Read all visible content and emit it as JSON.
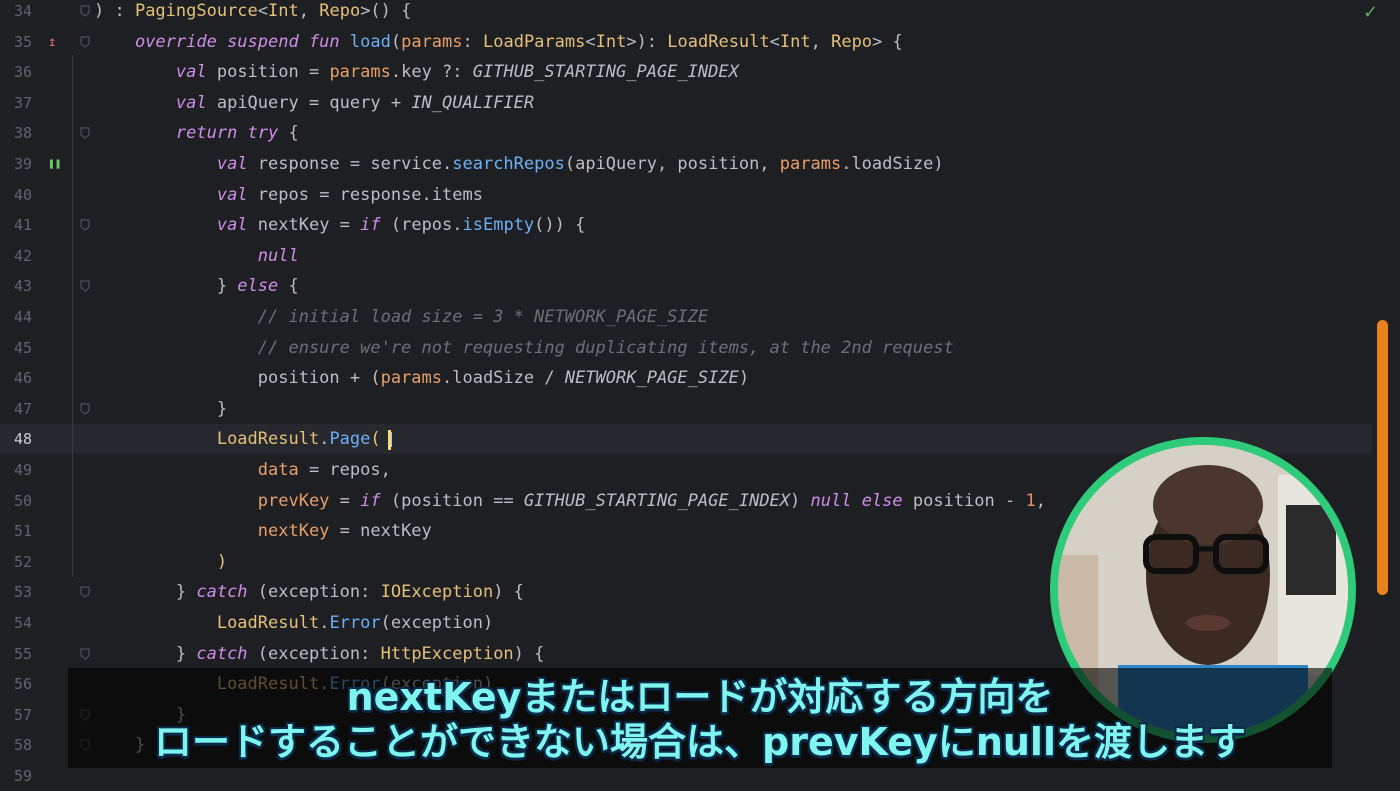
{
  "editor": {
    "lines": [
      {
        "n": "34",
        "tokens": [
          [
            "",
            ") : "
          ],
          [
            "ty",
            "PagingSource"
          ],
          [
            "",
            "<"
          ],
          [
            "ty",
            "Int"
          ],
          [
            "",
            ", "
          ],
          [
            "ty",
            "Repo"
          ],
          [
            "",
            ">() {"
          ]
        ]
      },
      {
        "n": "35",
        "tokens": [
          [
            "",
            "    "
          ],
          [
            "kw",
            "override suspend fun "
          ],
          [
            "fn",
            "load"
          ],
          [
            "",
            "("
          ],
          [
            "pm",
            "params"
          ],
          [
            "",
            ": "
          ],
          [
            "ty",
            "LoadParams"
          ],
          [
            "",
            "<"
          ],
          [
            "ty",
            "Int"
          ],
          [
            "",
            ">): "
          ],
          [
            "ty",
            "LoadResult"
          ],
          [
            "",
            "<"
          ],
          [
            "ty",
            "Int"
          ],
          [
            "",
            ", "
          ],
          [
            "ty",
            "Repo"
          ],
          [
            "",
            "> {"
          ]
        ]
      },
      {
        "n": "36",
        "tokens": [
          [
            "",
            "        "
          ],
          [
            "kw",
            "val "
          ],
          [
            "",
            "position = "
          ],
          [
            "pm",
            "params"
          ],
          [
            "",
            ".key ?: "
          ],
          [
            "st",
            "GITHUB_STARTING_PAGE_INDEX"
          ]
        ]
      },
      {
        "n": "37",
        "tokens": [
          [
            "",
            "        "
          ],
          [
            "kw",
            "val "
          ],
          [
            "",
            "apiQuery = query + "
          ],
          [
            "st",
            "IN_QUALIFIER"
          ]
        ]
      },
      {
        "n": "38",
        "tokens": [
          [
            "",
            "        "
          ],
          [
            "kw",
            "return try "
          ],
          [
            "",
            "{"
          ]
        ]
      },
      {
        "n": "39",
        "tokens": [
          [
            "",
            "            "
          ],
          [
            "kw",
            "val "
          ],
          [
            "",
            "response = service."
          ],
          [
            "fn",
            "searchRepos"
          ],
          [
            "",
            "(apiQuery, position, "
          ],
          [
            "pm",
            "params"
          ],
          [
            "",
            ".loadSize)"
          ]
        ]
      },
      {
        "n": "40",
        "tokens": [
          [
            "",
            "            "
          ],
          [
            "kw",
            "val "
          ],
          [
            "",
            "repos = response.items"
          ]
        ]
      },
      {
        "n": "41",
        "tokens": [
          [
            "",
            "            "
          ],
          [
            "kw",
            "val "
          ],
          [
            "",
            "nextKey = "
          ],
          [
            "kw",
            "if "
          ],
          [
            "",
            "(repos."
          ],
          [
            "fn",
            "isEmpty"
          ],
          [
            "",
            "()) {"
          ]
        ]
      },
      {
        "n": "42",
        "tokens": [
          [
            "",
            "                "
          ],
          [
            "kw",
            "null"
          ]
        ]
      },
      {
        "n": "43",
        "tokens": [
          [
            "",
            "            } "
          ],
          [
            "kw",
            "else "
          ],
          [
            "",
            "{"
          ]
        ]
      },
      {
        "n": "44",
        "tokens": [
          [
            "",
            "                "
          ],
          [
            "cm",
            "// initial load size = 3 * NETWORK_PAGE_SIZE"
          ]
        ]
      },
      {
        "n": "45",
        "tokens": [
          [
            "",
            "                "
          ],
          [
            "cm",
            "// ensure we're not requesting duplicating items, at the 2nd request"
          ]
        ]
      },
      {
        "n": "46",
        "tokens": [
          [
            "",
            "                position + ("
          ],
          [
            "pm",
            "params"
          ],
          [
            "",
            ".loadSize / "
          ],
          [
            "st",
            "NETWORK_PAGE_SIZE"
          ],
          [
            "",
            ")"
          ]
        ]
      },
      {
        "n": "47",
        "tokens": [
          [
            "",
            "            }"
          ]
        ]
      },
      {
        "n": "48",
        "tokens": [
          [
            "",
            "            "
          ],
          [
            "ty",
            "LoadResult"
          ],
          [
            "",
            "."
          ],
          [
            "fn",
            "Page"
          ],
          [
            "ty",
            "("
          ]
        ]
      },
      {
        "n": "49",
        "tokens": [
          [
            "",
            "                "
          ],
          [
            "pm",
            "data"
          ],
          [
            "",
            " = repos,"
          ]
        ]
      },
      {
        "n": "50",
        "tokens": [
          [
            "",
            "                "
          ],
          [
            "pm",
            "prevKey"
          ],
          [
            "",
            " = "
          ],
          [
            "kw",
            "if "
          ],
          [
            "",
            "(position == "
          ],
          [
            "st",
            "GITHUB_STARTING_PAGE_INDEX"
          ],
          [
            "",
            ") "
          ],
          [
            "kw",
            "null else "
          ],
          [
            "",
            "position - "
          ],
          [
            "num",
            "1"
          ],
          [
            "",
            ","
          ]
        ]
      },
      {
        "n": "51",
        "tokens": [
          [
            "",
            "                "
          ],
          [
            "pm",
            "nextKey"
          ],
          [
            "",
            " = nextKey"
          ]
        ]
      },
      {
        "n": "52",
        "tokens": [
          [
            "",
            "            "
          ],
          [
            "ty",
            ")"
          ]
        ]
      },
      {
        "n": "53",
        "tokens": [
          [
            "",
            "        } "
          ],
          [
            "kw",
            "catch "
          ],
          [
            "",
            "(exception: "
          ],
          [
            "ty",
            "IOException"
          ],
          [
            "",
            ") {"
          ]
        ]
      },
      {
        "n": "54",
        "tokens": [
          [
            "",
            "            "
          ],
          [
            "ty",
            "LoadResult"
          ],
          [
            "",
            "."
          ],
          [
            "fn",
            "Error"
          ],
          [
            "",
            "(exception)"
          ]
        ]
      },
      {
        "n": "55",
        "tokens": [
          [
            "",
            "        } "
          ],
          [
            "kw",
            "catch "
          ],
          [
            "",
            "(exception: "
          ],
          [
            "ty",
            "HttpException"
          ],
          [
            "",
            ") {"
          ]
        ]
      },
      {
        "n": "56",
        "tokens": [
          [
            "",
            "            "
          ],
          [
            "ty",
            "LoadResult"
          ],
          [
            "",
            "."
          ],
          [
            "fn",
            "Error"
          ],
          [
            "",
            "(exception)"
          ]
        ]
      },
      {
        "n": "57",
        "tokens": [
          [
            "",
            "        }"
          ]
        ]
      },
      {
        "n": "58",
        "tokens": [
          [
            "",
            "    }"
          ]
        ]
      },
      {
        "n": "59",
        "tokens": []
      }
    ],
    "current_line": "48",
    "fold_lines": [
      "34",
      "35",
      "38",
      "41",
      "43",
      "47",
      "53",
      "55",
      "57",
      "58"
    ]
  },
  "subtitle": {
    "line1": "nextKeyまたはロードが対応する方向を",
    "line2": "ロードすることができない場合は、prevKeyにnullを渡します"
  },
  "icons": {
    "status": "checkmark-icon",
    "gutter_35": "override-method-icon",
    "gutter_39": "debug-pause-icon"
  },
  "colors": {
    "background": "#1e1f22",
    "scrollbar": "#e9821c",
    "webcam_ring": "#2ecc7a",
    "subtitle_text": "#7ff5f0"
  }
}
